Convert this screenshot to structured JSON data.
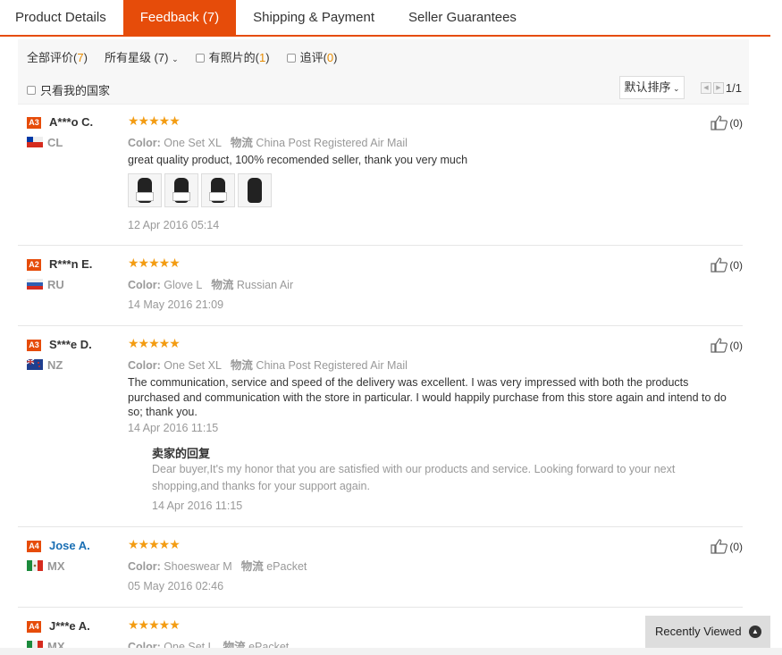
{
  "tabs": [
    {
      "label": "Product Details"
    },
    {
      "label": "Feedback (7)"
    },
    {
      "label": "Shipping & Payment"
    },
    {
      "label": "Seller Guarantees"
    }
  ],
  "filters": {
    "all_label": "全部评价",
    "all_count": "7",
    "rating_label": "所有星级 (7)",
    "photos_label": "有照片的",
    "photos_count": "1",
    "additional_label": "追评",
    "additional_count": "0",
    "my_country_label": "只看我的国家",
    "sort_label": "默认排序",
    "page": "1/1"
  },
  "reviews": [
    {
      "level": "A3",
      "name": "A***o C.",
      "country": "CL",
      "stars": "★★★★★",
      "color_label": "Color:",
      "color": "One Set XL",
      "ship_label": "物流",
      "ship": "China Post Registered Air Mail",
      "text": "great quality product, 100% recomended seller, thank you very much",
      "date": "12 Apr 2016 05:14",
      "helpful": "(0)"
    },
    {
      "level": "A2",
      "name": "R***n E.",
      "country": "RU",
      "stars": "★★★★★",
      "color_label": "Color:",
      "color": "Glove L",
      "ship_label": "物流",
      "ship": "Russian Air",
      "text": "",
      "date": "14 May 2016 21:09",
      "helpful": "(0)"
    },
    {
      "level": "A3",
      "name": "S***e D.",
      "country": "NZ",
      "stars": "★★★★★",
      "color_label": "Color:",
      "color": "One Set XL",
      "ship_label": "物流",
      "ship": "China Post Registered Air Mail",
      "text": "The communication, service and speed of the delivery was excellent. I was very impressed with both the products purchased and communication with the store in particular. I would happily purchase from this store again and intend to do so; thank you.",
      "date": "14 Apr 2016 11:15",
      "helpful": "(0)",
      "reply_title": "卖家的回复",
      "reply_text": "Dear buyer,It's my honor that you are satisfied with our products and service. Looking forward to your next shopping,and thanks for your support again.",
      "reply_date": "14 Apr 2016 11:15"
    },
    {
      "level": "A4",
      "name": "Jose A.",
      "country": "MX",
      "stars": "★★★★★",
      "color_label": "Color:",
      "color": "Shoeswear M",
      "ship_label": "物流",
      "ship": "ePacket",
      "text": "",
      "date": "05 May 2016 02:46",
      "helpful": "(0)"
    },
    {
      "level": "A4",
      "name": "J***e A.",
      "country": "MX",
      "stars": "★★★★★",
      "color_label": "Color:",
      "color": "One Set L",
      "ship_label": "物流",
      "ship": "ePacket"
    }
  ],
  "recently_viewed": "Recently Viewed",
  "colors": {
    "accent": "#e64c0a",
    "star": "#f39c12",
    "count": "#e68a00",
    "link": "#1a6fb4"
  }
}
